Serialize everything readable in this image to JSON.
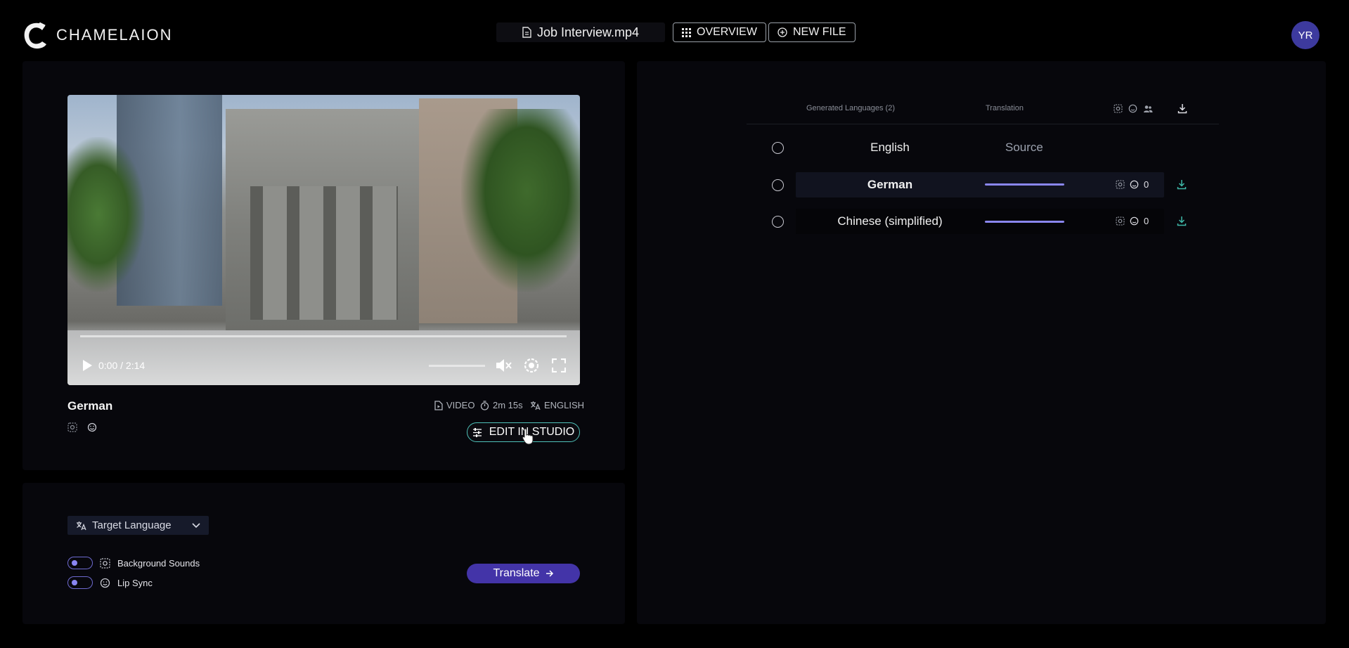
{
  "app": {
    "brand": "CHAMELAION",
    "file_name": "Job Interview.mp4",
    "overview_label": "OVERVIEW",
    "new_file_label": "NEW FILE",
    "avatar_initials": "YR",
    "accent_color": "#4334a8",
    "teal_color": "#4ec0b8"
  },
  "player": {
    "time": "0:00 / 2:14",
    "language": "German",
    "meta": {
      "type": "VIDEO",
      "duration": "2m 15s",
      "source_language": "ENGLISH"
    },
    "edit_label": "EDIT IN STUDIO"
  },
  "settings": {
    "target_language_label": "Target Language",
    "background_sounds_label": "Background Sounds",
    "lip_sync_label": "Lip Sync",
    "translate_label": "Translate"
  },
  "languages_table": {
    "header_languages": "Generated Languages (2)",
    "header_translation": "Translation",
    "rows": [
      {
        "language": "English",
        "status": "Source",
        "progress": null,
        "count": null
      },
      {
        "language": "German",
        "status": "",
        "progress": 1.0,
        "count": "0"
      },
      {
        "language": "Chinese (simplified)",
        "status": "",
        "progress": 1.0,
        "count": "0"
      }
    ]
  }
}
